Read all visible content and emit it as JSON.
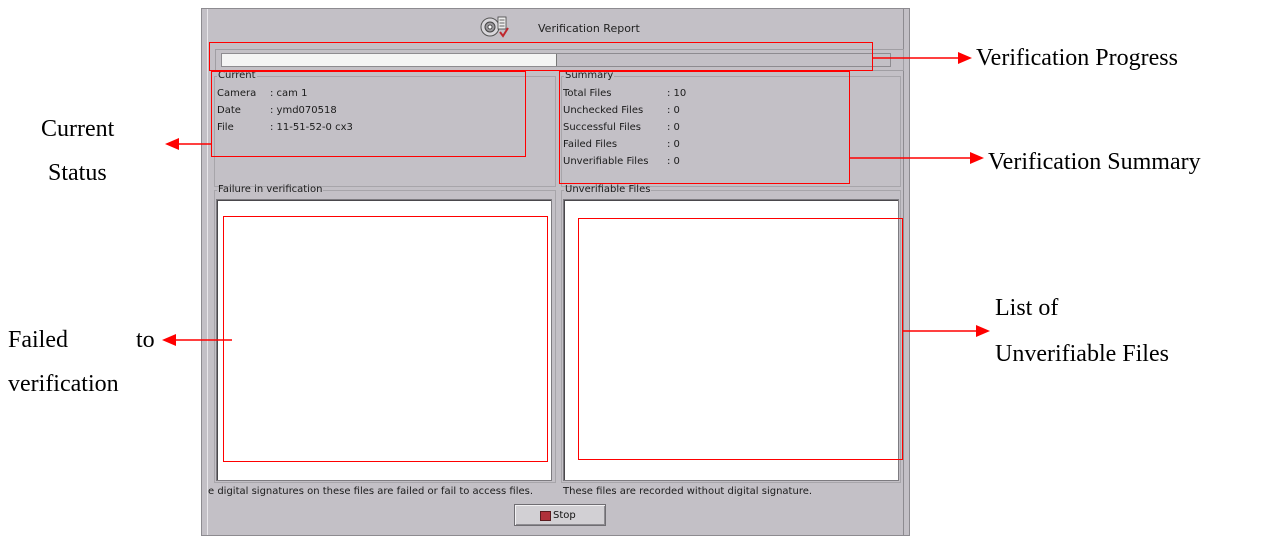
{
  "window": {
    "title": "Verification Report",
    "title_icon": "verification-disc-icon"
  },
  "progress": {
    "fraction": 0.5
  },
  "current": {
    "legend": "Current",
    "rows": [
      {
        "key": "Camera",
        "value": ": cam 1"
      },
      {
        "key": "Date",
        "value": ": ymd070518"
      },
      {
        "key": "File",
        "value": ": 11-51-52-0 cx3"
      }
    ]
  },
  "summary": {
    "legend": "Summary",
    "rows": [
      {
        "key": "Total Files",
        "value": ": 10"
      },
      {
        "key": "Unchecked Files",
        "value": ": 0"
      },
      {
        "key": "Successful Files",
        "value": ": 0"
      },
      {
        "key": "Failed Files",
        "value": ": 0"
      },
      {
        "key": "Unverifiable Files",
        "value": ": 0"
      }
    ]
  },
  "failure_list": {
    "legend": "Failure in verification"
  },
  "unverifiable_list": {
    "legend": "Unverifiable Files"
  },
  "status": {
    "failure_note": "e digital signatures on these files are failed or fail to access files.",
    "unverifiable_note": "These files are recorded without digital signature."
  },
  "buttons": {
    "stop_label": "Stop",
    "stop_icon": "stop-icon"
  },
  "annotations": {
    "progress": "Verification Progress",
    "current_line1": "Current",
    "current_line2": "Status",
    "summary": "Verification Summary",
    "failed_line1_a": "Failed",
    "failed_line1_b": "to",
    "failed_line2": "verification",
    "unverifiable_line1": "List of",
    "unverifiable_line2": "Unverifiable Files",
    "highlight_color": "#ff0000"
  }
}
